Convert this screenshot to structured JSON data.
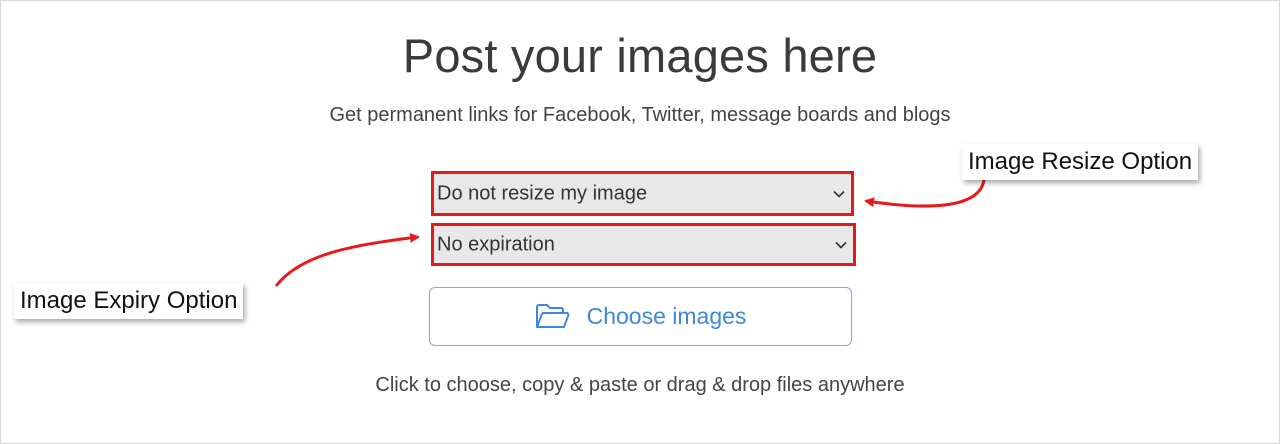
{
  "page": {
    "title": "Post your images here",
    "subtitle": "Get permanent links for Facebook, Twitter, message boards and blogs",
    "hint": "Click to choose, copy & paste or drag & drop files anywhere"
  },
  "resize_select": {
    "value": "Do not resize my image",
    "icon": "chevron-down-icon"
  },
  "expiry_select": {
    "value": "No expiration",
    "icon": "chevron-down-icon"
  },
  "choose_button": {
    "label": "Choose images",
    "icon": "folder-open-icon"
  },
  "annotations": {
    "resize_callout": "Image Resize Option",
    "expiry_callout": "Image Expiry Option"
  },
  "colors": {
    "highlight": "#e51a1a",
    "accent": "#3f86e0",
    "select_bg": "#e8e8e8"
  }
}
